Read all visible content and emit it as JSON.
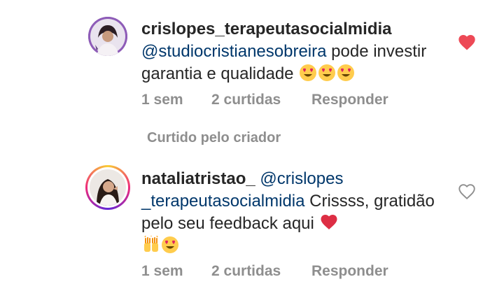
{
  "comments": [
    {
      "username": "crislopes_terapeutasocialmidia",
      "mention": "@studiocristianesobreira",
      "text_after_mention": " pode investir garantia e qualidade",
      "emojis": [
        "heart-eyes-emoji",
        "heart-eyes-emoji",
        "heart-eyes-emoji"
      ],
      "time": "1 sem",
      "likes": "2 curtidas",
      "reply_label": "Responder",
      "liked": true,
      "like_color": "#ed4956"
    },
    {
      "username": "nataliatristao_",
      "mention": "@crislopes _terapeutasocialmidia",
      "text_after_mention": " Crissss, gratidão pelo seu feedback aqui",
      "emojis": [
        "red-heart-emoji",
        "raising-hands-emoji",
        "heart-eyes-emoji"
      ],
      "time": "1 sem",
      "likes": "2 curtidas",
      "reply_label": "Responder",
      "liked": false,
      "like_color": "#8e8e8e"
    }
  ],
  "liked_by_creator": "Curtido pelo criador"
}
